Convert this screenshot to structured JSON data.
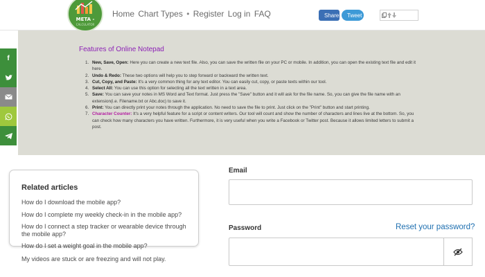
{
  "header": {
    "logo_text": "META -",
    "logo_subtext": "CALCULATOR",
    "nav": [
      "Home",
      "Chart Types",
      "Register",
      "Log in",
      "FAQ"
    ],
    "nav_separator": "•",
    "share_fb_label": "Share",
    "share_tw_label": "Tweet"
  },
  "notepad": {
    "title": "Features of Online Notepad",
    "features": [
      {
        "num": "1.",
        "bold": "New, Save, Open:",
        "text": " Here you can create a new text file. Also, you can save the written file on your PC or mobile. In addition, you can open the existing text file and edit it here."
      },
      {
        "num": "2.",
        "bold": "Undo & Redo:",
        "text": " These two options will help you to step forward or backward the written text."
      },
      {
        "num": "3.",
        "bold": "Cut, Copy, and Paste:",
        "text": " It's a very common thing for any text editor. You can easily cut, copy, or paste texts within our tool."
      },
      {
        "num": "4.",
        "bold": "Select All:",
        "text": " You can use this option for selecting all the text written in a text area."
      },
      {
        "num": "5.",
        "bold": "Save:",
        "text": " You can save your notes in MS Word and Text format. Just press the \"Save\" button and it will ask for the file name. So, you can give the file name with an extension(i.e. Filename.txt or Abc.doc) to save it."
      },
      {
        "num": "6.",
        "bold": "Print:",
        "text": " You can directly print your notes through the application. No need to save the file to print. Just click on the \"Print\" button and start printing."
      },
      {
        "num": "7.",
        "bold": "Character Counter:",
        "text": " It's a very helpful feature for a script or content writers. Our tool will count and show the number of characters and lines live at the bottom. So, you can check how many characters you have written. Furthermore, it is very useful when you write a Facebook or Twitter post. Because it allows limited letters to submit a post."
      }
    ]
  },
  "social_sidebar": [
    {
      "icon": "facebook-icon",
      "glyph": "f",
      "color": "#3d8f3b"
    },
    {
      "icon": "twitter-icon",
      "glyph": "•",
      "color": "#3d8f3b"
    },
    {
      "icon": "email-icon",
      "glyph": "✉",
      "color": "#8a8a8a"
    },
    {
      "icon": "whatsapp-icon",
      "glyph": "✆",
      "color": "#9fc83d"
    },
    {
      "icon": "telegram-icon",
      "glyph": "➤",
      "color": "#3d8f3b"
    }
  ],
  "related": {
    "title": "Related articles",
    "links": [
      "How do I download the mobile app?",
      "How do I complete my weekly check-in in the mobile app?",
      "How do I connect a step tracker or wearable device through the mobile app?",
      "How do I set a weight goal in the mobile app?",
      "My videos are stuck or are freezing and will not play."
    ]
  },
  "login": {
    "email_label": "Email",
    "email_value": "",
    "password_label": "Password",
    "password_value": "",
    "reset_link": "Reset your password?",
    "toggle_icon": "eye-slash-icon"
  }
}
